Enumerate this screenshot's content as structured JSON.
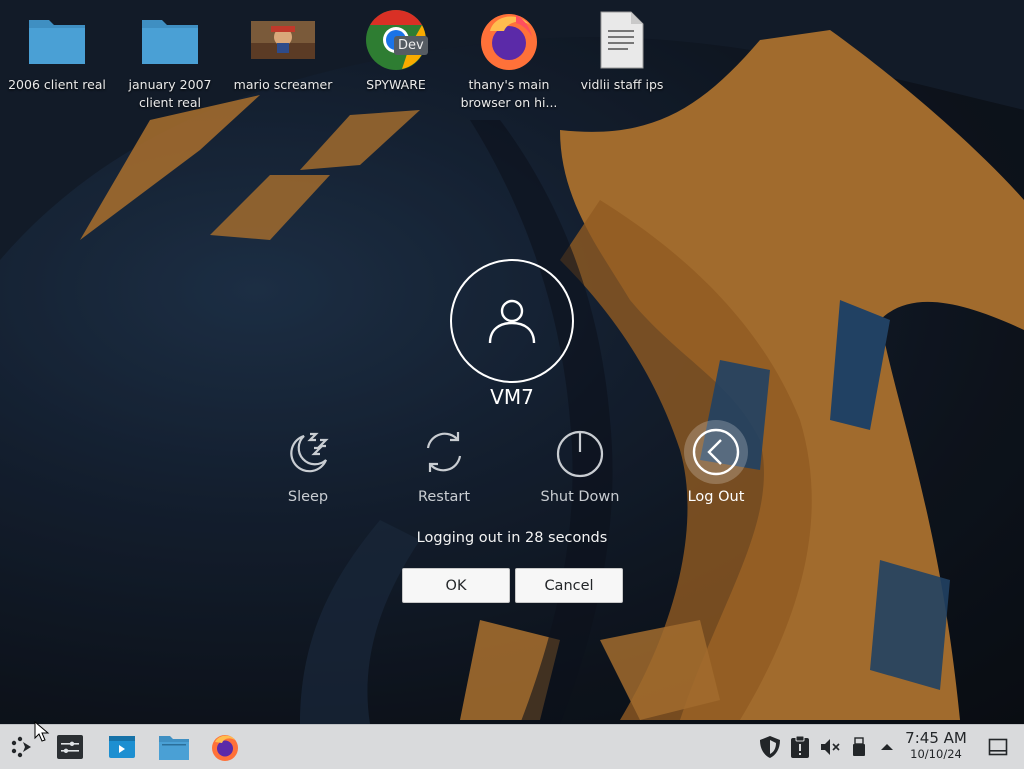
{
  "desktop": {
    "icons": [
      {
        "label": "2006 client real",
        "icon": "folder-icon"
      },
      {
        "label": "january 2007 client real",
        "icon": "folder-icon"
      },
      {
        "label": "mario screamer",
        "icon": "image-thumbnail"
      },
      {
        "label": "SPYWARE",
        "icon": "chrome-dev-icon",
        "badge": "Dev"
      },
      {
        "label": "thany's main browser on hi...",
        "icon": "firefox-icon"
      },
      {
        "label": "vidlii staff ips",
        "icon": "text-document-icon"
      }
    ]
  },
  "logout_dialog": {
    "username": "VM7",
    "actions": [
      {
        "label": "Sleep",
        "icon": "sleep-icon"
      },
      {
        "label": "Restart",
        "icon": "restart-icon"
      },
      {
        "label": "Shut Down",
        "icon": "shutdown-icon"
      },
      {
        "label": "Log Out",
        "icon": "logout-icon",
        "selected": true
      }
    ],
    "countdown_text": "Logging out in 28 seconds",
    "ok_label": "OK",
    "cancel_label": "Cancel"
  },
  "taskbar": {
    "launchers": [
      "application-launcher-icon",
      "terminal-settings-icon",
      "discover-icon",
      "file-manager-icon",
      "firefox-icon"
    ],
    "tray": [
      "shield-icon",
      "clipboard-icon",
      "volume-muted-icon",
      "usb-icon",
      "tray-expand-arrow-icon"
    ],
    "clock": {
      "time": "7:45 AM",
      "date": "10/10/24"
    },
    "show_desktop_icon": "show-desktop-icon"
  },
  "colors": {
    "taskbar_bg": "#d9dadc",
    "folder_blue": "#3f8fc2",
    "wallpaper_orange": "#e0953f",
    "wallpaper_blue": "#2f5b8a"
  }
}
